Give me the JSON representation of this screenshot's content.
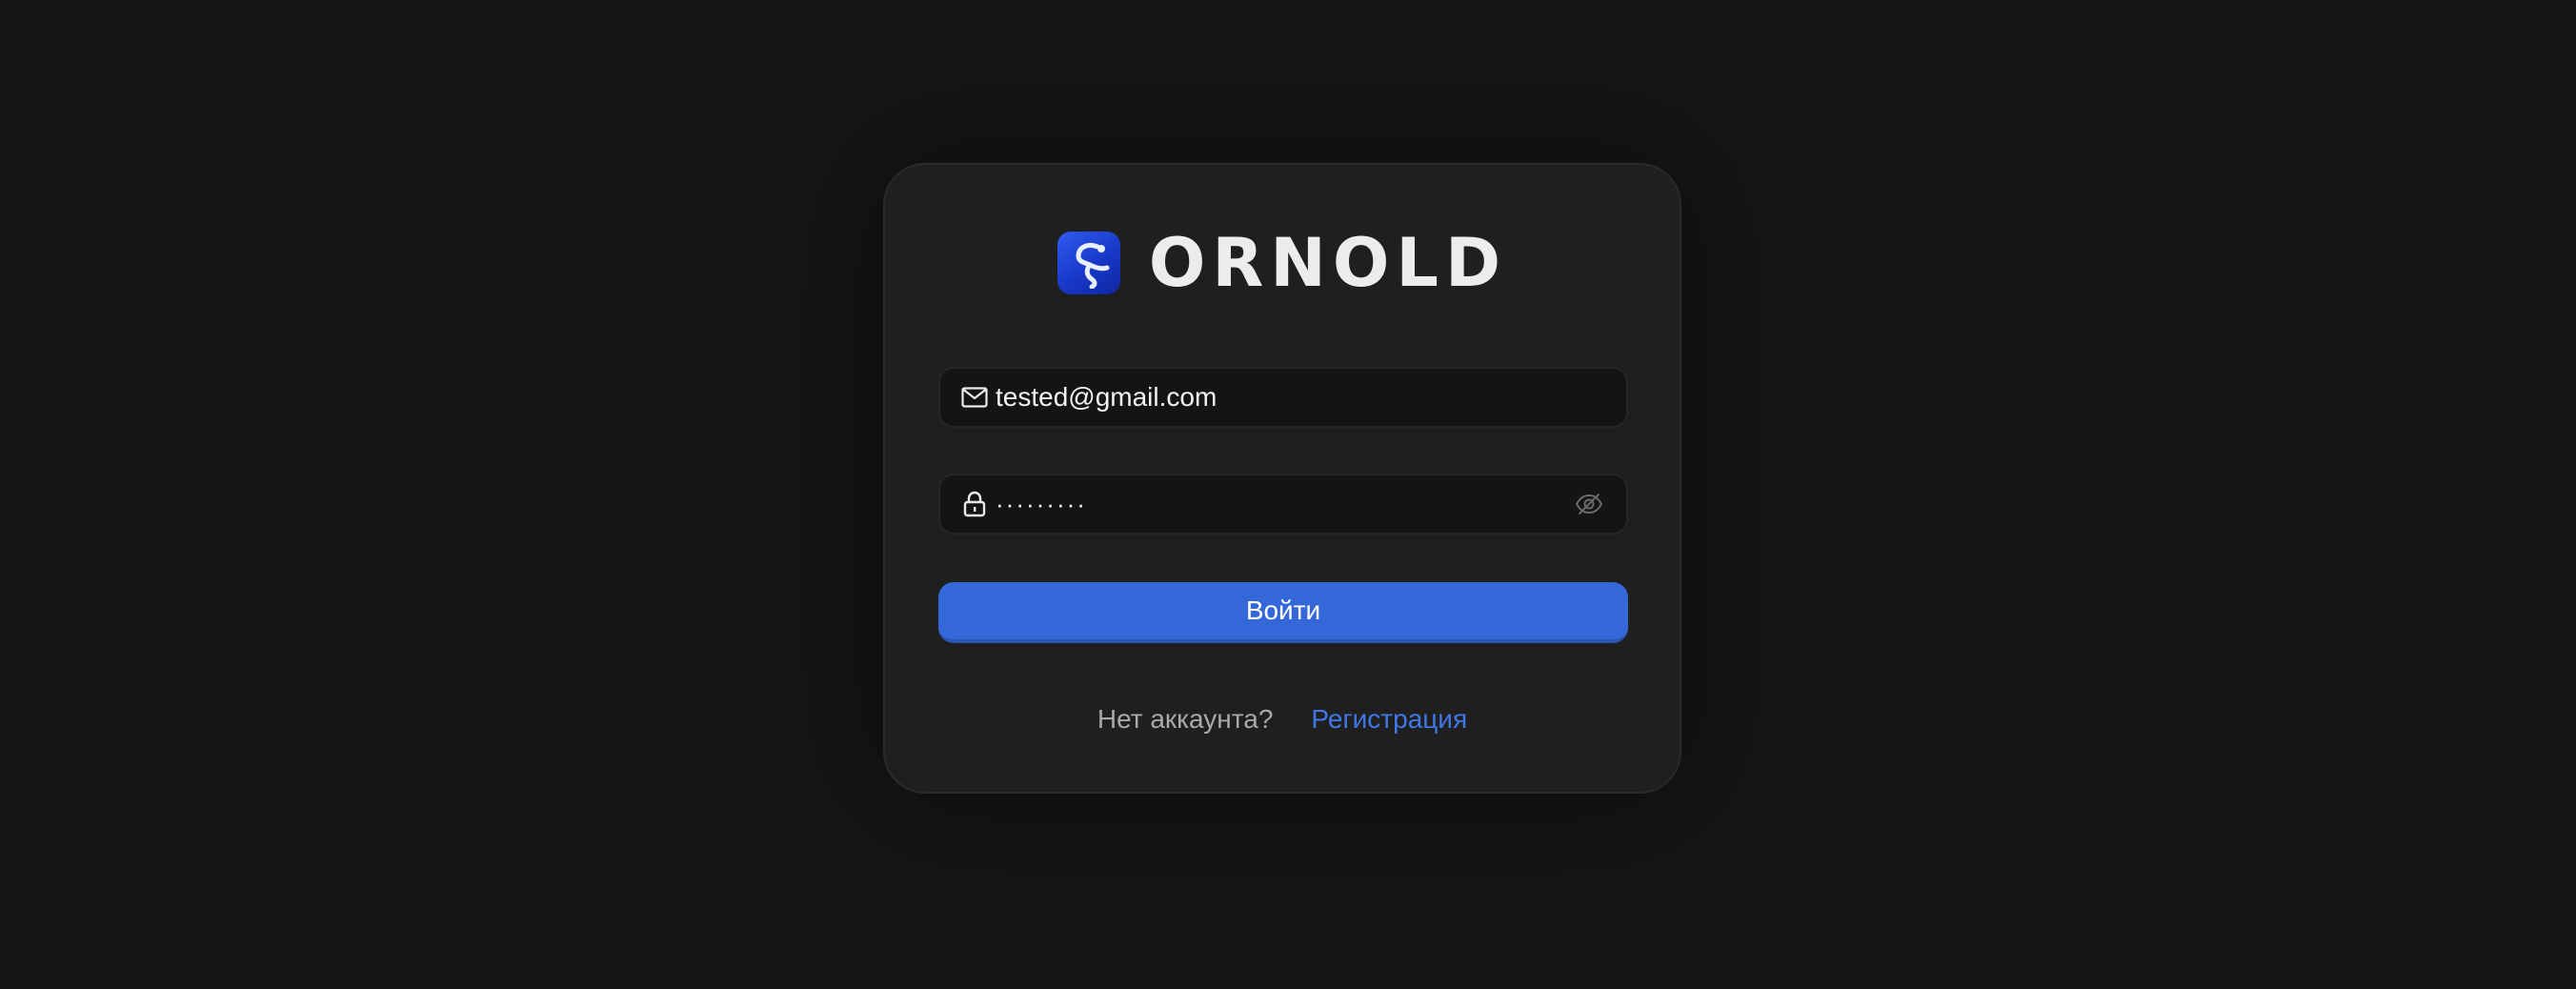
{
  "brand": {
    "name": "ORNOLD",
    "logo_icon": "ornold-logo-icon",
    "logo_color": "#2448d8"
  },
  "form": {
    "email": {
      "icon": "mail-icon",
      "value": "tested@gmail.com"
    },
    "password": {
      "icon": "lock-icon",
      "value": "·········",
      "toggle_icon": "eye-off-icon"
    },
    "submit_label": "Войти",
    "submit_color": "#3468d8"
  },
  "footer": {
    "prompt": "Нет аккаунта?",
    "register_link": "Регистрация",
    "link_color": "#3f78e6"
  }
}
